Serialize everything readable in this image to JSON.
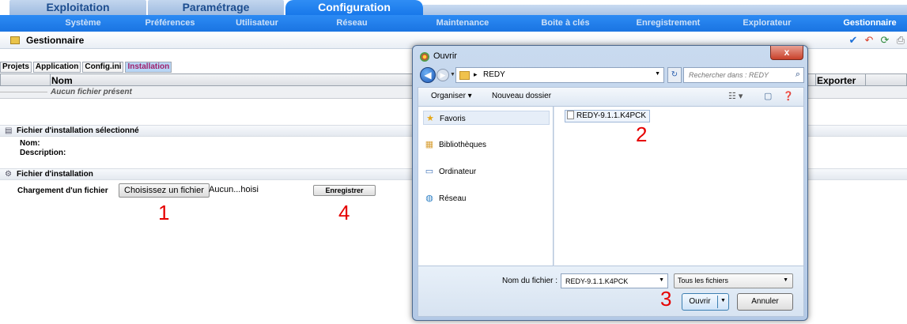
{
  "main_tabs": [
    "Exploitation",
    "Paramétrage",
    "Configuration"
  ],
  "sub_tabs": [
    "Système",
    "Préférences",
    "Utilisateur",
    "Réseau",
    "Maintenance",
    "Boite à clés",
    "Enregistrement",
    "Explorateur",
    "Gestionnaire"
  ],
  "title": "Gestionnaire",
  "inner_tabs": [
    "Projets",
    "Application",
    "Config.ini",
    "Installation"
  ],
  "table": {
    "col_name": "Nom",
    "col_export": "Exporter",
    "empty_text": "Aucun fichier présent"
  },
  "selected_section": {
    "title": "Fichier d'installation sélectionné",
    "name_label": "Nom:",
    "description_label": "Description:"
  },
  "install_section": {
    "title": "Fichier d'installation",
    "upload_label": "Chargement d'un fichier",
    "choose_button": "Choisissez un fichier",
    "file_status": "Aucun...hoisi",
    "save_button": "Enregistrer"
  },
  "annotations": [
    "1",
    "2",
    "3",
    "4"
  ],
  "dialog": {
    "title": "Ouvrir",
    "close": "x",
    "path": "REDY",
    "search_placeholder": "Rechercher dans : REDY",
    "organize": "Organiser ▾",
    "new_folder": "Nouveau dossier",
    "nav": [
      "Favoris",
      "Bibliothèques",
      "Ordinateur",
      "Réseau"
    ],
    "file": "REDY-9.1.1.K4PCK",
    "filename_label": "Nom du fichier :",
    "filename_value": "REDY-9.1.1.K4PCK",
    "filetype": "Tous les fichiers",
    "open_button": "Ouvrir",
    "cancel_button": "Annuler"
  }
}
